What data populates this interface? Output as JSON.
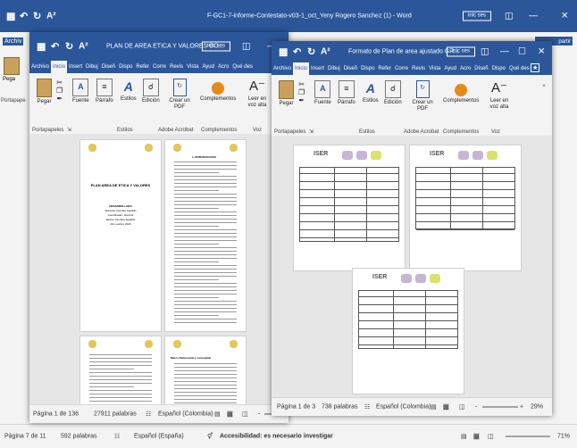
{
  "back": {
    "title": "F-GC1-7-informe-Contestato-v03-1_oct_Yeny Rogero Sanchez (1) - Word",
    "account": "inic ses",
    "archivo": "Archiv",
    "pegar": "Pega",
    "portapapeles": "Portapape",
    "share_fragment": "partir",
    "status_page": "Página 7 de 11",
    "status_words": "592 palabras",
    "status_lang": "Español (España)",
    "status_access": "Accesibilidad: es necesario investigar",
    "status_zoom": "71%"
  },
  "left": {
    "title": "PLAN DE AREA ETICA Y VALORES CO...",
    "account": "inic ses",
    "tabs": [
      "Archivo",
      "Inicio",
      "Insert",
      "Dibuj",
      "Diseñ",
      "Dispo",
      "Refer",
      "Corre",
      "Revis",
      "Vista",
      "Ayud",
      "Acro",
      "Qué des"
    ],
    "ribbon": {
      "pegar": "Pegar",
      "fuente": "Fuente",
      "parrafo": "Párrafo",
      "estilos": "Estilos",
      "edicion": "Edición",
      "crear_pdf": "Crear un PDF",
      "complementos": "Complementos",
      "leer": "Leer en voz alta"
    },
    "groups": {
      "portapapeles": "Portapapeles",
      "estilos": "Estilos",
      "adobe": "Adobe Acrobat",
      "complementos": "Complementos",
      "voz": "Voz"
    },
    "page1": {
      "heading": "PLAN AREA DE ETICA Y VALORES",
      "lines": [
        "DESARROLLADO",
        "Docente: Nombre Apellido",
        "Coordinador: Nombre",
        "Rector: Nombre Apellido",
        "Año Lectivo 2023"
      ]
    },
    "page2_heading": "1. INTRODUCCION",
    "page4_heading": "Marco Referencial y conceptual",
    "status": {
      "page": "Página 1 de 136",
      "words": "27911 palabras",
      "lang": "Español (Colombia)",
      "zoom_minus": "-",
      "zoom_plus": "+"
    }
  },
  "right": {
    "title": "Formato de Plan de area ajustado GR...",
    "account": "inic ses",
    "tabs": [
      "Archivo",
      "Inicio",
      "Insert",
      "Dibuj",
      "Diseñ",
      "Dispo",
      "Refer",
      "Corre",
      "Revis",
      "Vista",
      "Ayud",
      "Acro",
      "Diseñ",
      "Dispo",
      "Qué des"
    ],
    "ribbon": {
      "pegar": "Pegar",
      "fuente": "Fuente",
      "parrafo": "Párrafo",
      "estilos": "Estilos",
      "edicion": "Edición",
      "crear_pdf": "Crear un PDF",
      "complementos": "Complementos",
      "leer": "Leer en voz alta"
    },
    "groups": {
      "portapapeles": "Portapapeles",
      "estilos": "Estilos",
      "adobe": "Adobe Acrobat",
      "complementos": "Complementos",
      "voz": "Voz"
    },
    "logo_text": "ISER",
    "status": {
      "page": "Página 1 de 3",
      "words": "738 palabras",
      "lang": "Español (Colombia)",
      "zoom_minus": "-",
      "zoom_plus": "+",
      "zoom": "29%"
    }
  },
  "colors": {
    "word_blue": "#2b579a",
    "ribbon_bg": "#f3f3f3",
    "doc_bg": "#e6e6e6"
  },
  "icons": [
    "save-icon",
    "undo-icon",
    "redo-icon",
    "font-size-icon",
    "paste-icon",
    "bullets-icon",
    "styles-icon",
    "search-icon",
    "pdf-icon",
    "addin-icon",
    "read-aloud-icon",
    "lightbulb-icon",
    "minimize-icon",
    "maximize-icon",
    "close-icon",
    "restore-icon"
  ]
}
